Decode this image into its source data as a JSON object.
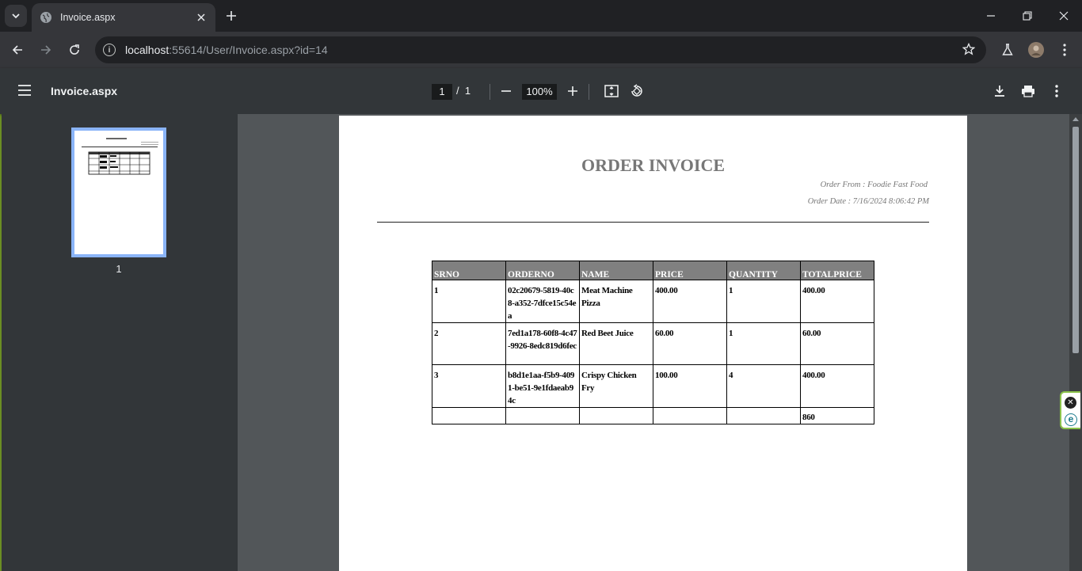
{
  "browser": {
    "tab_title": "Invoice.aspx",
    "url_host": "localhost",
    "url_path": ":55614/User/Invoice.aspx?id=14"
  },
  "pdf_toolbar": {
    "doc_title": "Invoice.aspx",
    "current_page": "1",
    "page_sep": "/",
    "total_pages": "1",
    "zoom": "100%"
  },
  "sidebar": {
    "thumb_label": "1"
  },
  "invoice": {
    "title": "ORDER INVOICE",
    "order_from": "Order From : Foodie Fast Food",
    "order_date": "Order Date : 7/16/2024 8:06:42 PM",
    "headers": [
      "SRNO",
      "ORDERNO",
      "NAME",
      "PRICE",
      "QUANTITY",
      "TOTALPRICE"
    ],
    "rows": [
      [
        "1",
        "02c20679-5819-40c8-a352-7dfce15c54ea",
        "Meat Machine Pizza",
        "400.00",
        "1",
        "400.00"
      ],
      [
        "2",
        "7ed1a178-60f8-4c47-9926-8edc819d6fec",
        "Red Beet Juice",
        "60.00",
        "1",
        "60.00"
      ],
      [
        "3",
        "b8d1e1aa-f5b9-4091-be51-9e1fdaeab94c",
        "Crispy Chicken Fry",
        "100.00",
        "4",
        "400.00"
      ]
    ],
    "total": [
      "",
      "",
      "",
      "",
      "",
      "860"
    ]
  },
  "colors": {
    "accent_border": "#6b8e23",
    "thumb_highlight": "#8ab4f8",
    "table_header": "#808080"
  },
  "icons": [
    "tab-search-icon",
    "globe-icon",
    "close-icon",
    "new-tab-icon",
    "minimize-icon",
    "restore-icon",
    "window-close-icon",
    "back-icon",
    "forward-icon",
    "reload-icon",
    "info-icon",
    "star-icon",
    "labs-icon",
    "profile-avatar",
    "kebab-menu-icon",
    "hamburger-icon",
    "zoom-out-icon",
    "zoom-in-icon",
    "fit-page-icon",
    "rotate-icon",
    "download-icon",
    "print-icon",
    "more-icon"
  ]
}
